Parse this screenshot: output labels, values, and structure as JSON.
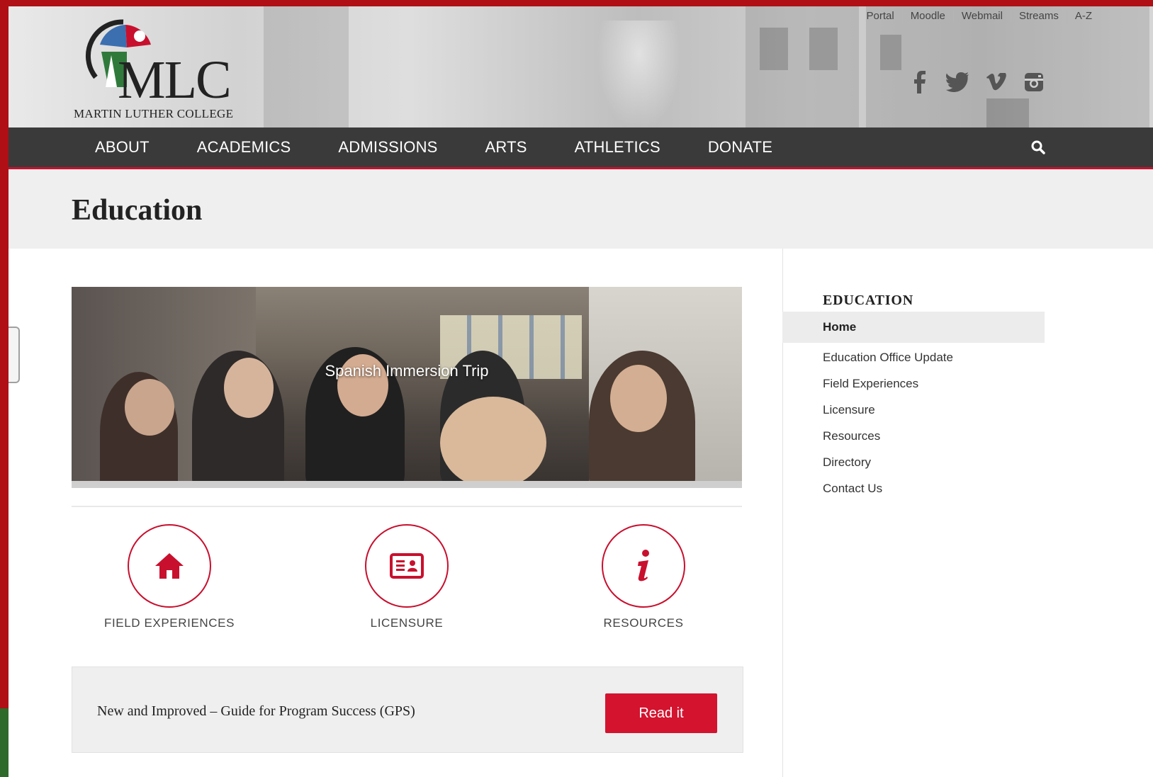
{
  "header": {
    "logo_text": "MLC",
    "logo_subtitle": "MARTIN LUTHER COLLEGE",
    "util_links": [
      "Portal",
      "Moodle",
      "Webmail",
      "Streams",
      "A-Z"
    ],
    "social_icons": [
      "facebook-icon",
      "twitter-icon",
      "vimeo-icon",
      "instagram-icon"
    ]
  },
  "nav": {
    "items": [
      "ABOUT",
      "ACADEMICS",
      "ADMISSIONS",
      "ARTS",
      "ATHLETICS",
      "DONATE"
    ],
    "search_icon": "search-icon"
  },
  "page": {
    "title": "Education"
  },
  "hero": {
    "caption": "Spanish Immersion Trip"
  },
  "features": [
    {
      "label": "FIELD EXPERIENCES",
      "icon": "home-icon"
    },
    {
      "label": "LICENSURE",
      "icon": "id-card-icon"
    },
    {
      "label": "RESOURCES",
      "icon": "info-icon"
    }
  ],
  "gps": {
    "text": "New and Improved – Guide for Program Success (GPS)",
    "button": "Read it"
  },
  "sidebar": {
    "title": "EDUCATION",
    "active": "Home",
    "items": [
      "Education Office Update",
      "Field Experiences",
      "Licensure",
      "Resources",
      "Directory",
      "Contact Us"
    ]
  },
  "colors": {
    "accent": "#c8102e",
    "nav_bg": "#3a3a3a",
    "frame": "#b00f16"
  }
}
